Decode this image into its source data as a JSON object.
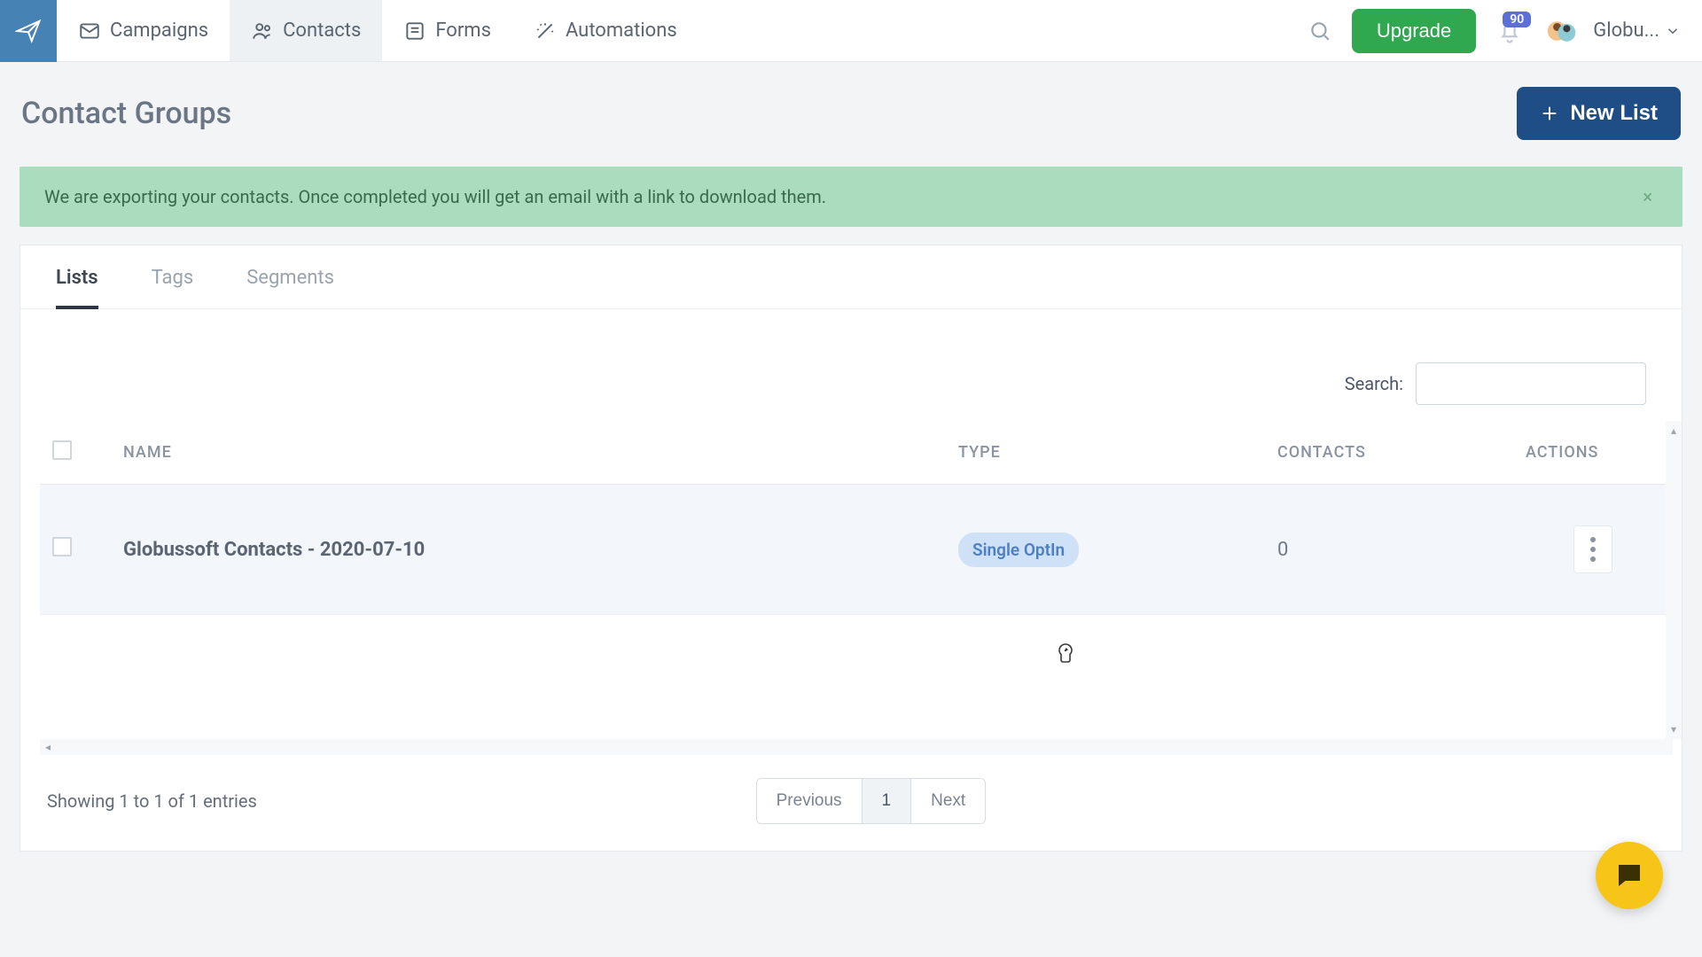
{
  "nav": {
    "items": [
      {
        "label": "Campaigns"
      },
      {
        "label": "Contacts"
      },
      {
        "label": "Forms"
      },
      {
        "label": "Automations"
      }
    ],
    "upgrade": "Upgrade",
    "notif_count": "90",
    "user_label": "Globu..."
  },
  "page": {
    "title": "Contact Groups",
    "new_list": "New List"
  },
  "alert": {
    "text": "We are exporting your contacts. Once completed you will get an email with a link to download them.",
    "close": "×"
  },
  "tabs": {
    "lists": "Lists",
    "tags": "Tags",
    "segments": "Segments"
  },
  "search": {
    "label": "Search:",
    "value": ""
  },
  "table": {
    "headers": {
      "name": "NAME",
      "type": "TYPE",
      "contacts": "CONTACTS",
      "actions": "ACTIONS"
    },
    "rows": [
      {
        "name": "Globussoft Contacts - 2020-07-10",
        "type": "Single OptIn",
        "contacts": "0"
      }
    ]
  },
  "footer": {
    "entries": "Showing 1 to 1 of 1 entries",
    "prev": "Previous",
    "page": "1",
    "next": "Next"
  }
}
